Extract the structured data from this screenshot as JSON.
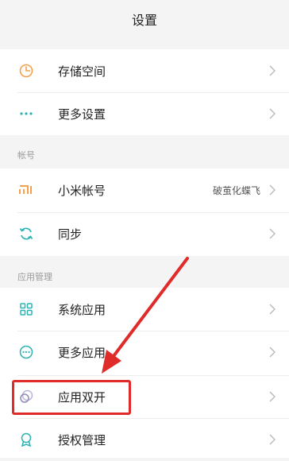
{
  "header": {
    "title": "设置"
  },
  "group1": {
    "items": [
      {
        "label": "存储空间",
        "icon": "clock-pie-icon"
      },
      {
        "label": "更多设置",
        "icon": "ellipsis-icon"
      }
    ]
  },
  "account": {
    "section_label": "帐号",
    "items": [
      {
        "label": "小米帐号",
        "value": "破茧化蝶飞",
        "icon": "mi-logo-icon"
      },
      {
        "label": "同步",
        "icon": "sync-icon"
      }
    ]
  },
  "apps": {
    "section_label": "应用管理",
    "items": [
      {
        "label": "系统应用",
        "icon": "grid-icon"
      },
      {
        "label": "更多应用",
        "icon": "more-circle-icon"
      },
      {
        "label": "应用双开",
        "icon": "dual-circle-icon"
      },
      {
        "label": "授权管理",
        "icon": "award-badge-icon"
      }
    ]
  },
  "colors": {
    "accent_orange": "#f5a04a",
    "accent_teal": "#2bb3b3",
    "highlight_red": "#e02b2b"
  }
}
